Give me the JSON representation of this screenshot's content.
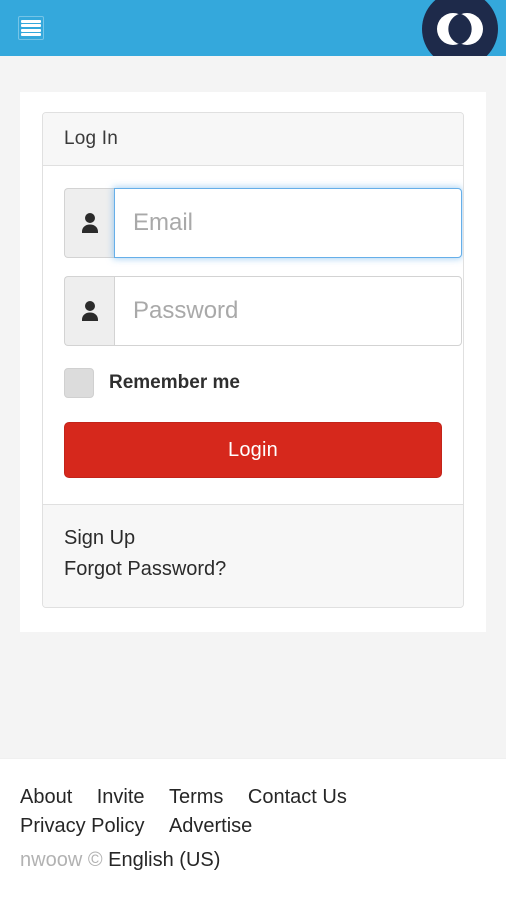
{
  "topbar": {
    "menu_icon": "hamburger-menu-icon",
    "logo_icon": "venn-circles-logo-icon",
    "background_color": "#34a8dc"
  },
  "login_panel": {
    "heading": "Log In",
    "email": {
      "icon": "user-icon",
      "placeholder": "Email",
      "value": "",
      "focused": true
    },
    "password": {
      "icon": "user-icon",
      "placeholder": "Password",
      "value": "",
      "focused": false
    },
    "remember_me": {
      "label": "Remember me",
      "checked": false
    },
    "submit_label": "Login",
    "submit_color": "#d6281c",
    "footer_links": [
      {
        "label": "Sign Up"
      },
      {
        "label": "Forgot Password?"
      }
    ]
  },
  "site_footer": {
    "links": [
      {
        "label": "About"
      },
      {
        "label": "Invite"
      },
      {
        "label": "Terms"
      },
      {
        "label": "Contact Us"
      },
      {
        "label": "Privacy Policy"
      },
      {
        "label": "Advertise"
      }
    ],
    "copyright": "nwoow ©",
    "language": "English (US)"
  }
}
